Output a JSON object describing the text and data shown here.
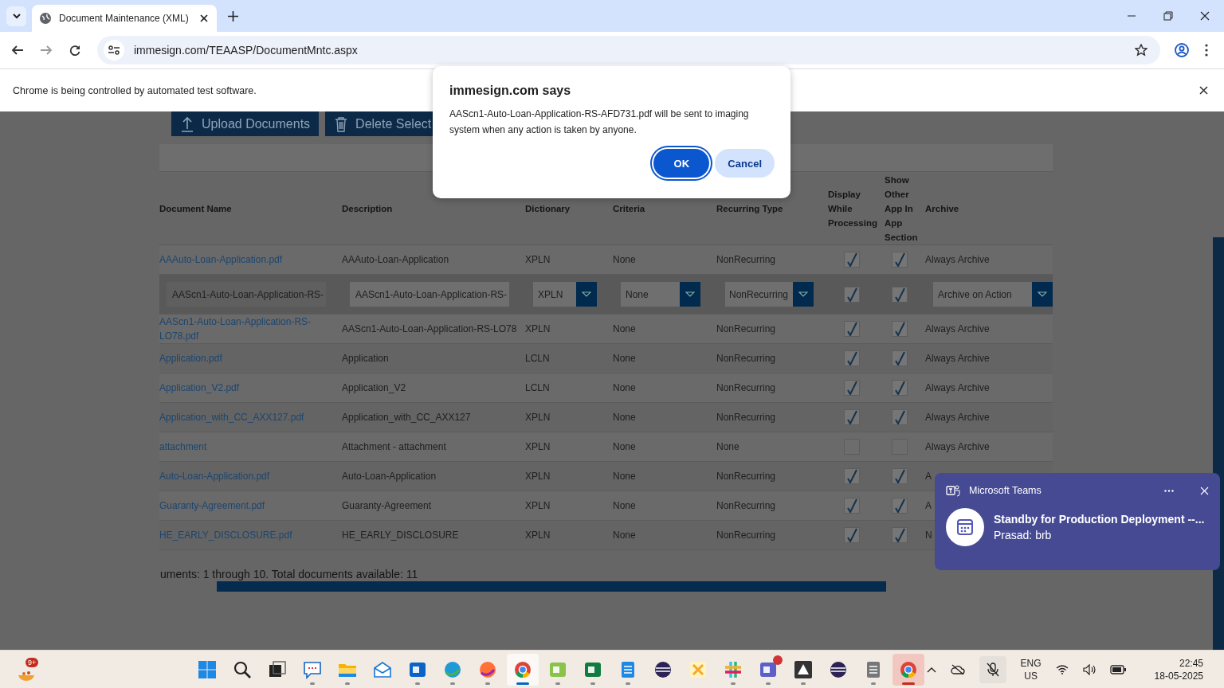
{
  "browser": {
    "tab_title": "Document Maintenance (XML)",
    "url": "immesign.com/TEAASP/DocumentMntc.aspx",
    "infobar": "Chrome is being controlled by automated test software."
  },
  "toolbar": {
    "buttons": [
      {
        "label": "Upload Documents",
        "kind": "upload"
      },
      {
        "label": "Delete Select",
        "kind": "delete"
      }
    ]
  },
  "table": {
    "columns": [
      "Document Name",
      "Description",
      "Dictionary",
      "Criteria",
      "Recurring Type",
      "Display While Processing",
      "Show Other App In App Section",
      "Archive"
    ],
    "rows": [
      {
        "kind": "view",
        "name": "AAAuto-Loan-Application.pdf",
        "description": "AAAuto-Loan-Application",
        "dictionary": "XPLN",
        "criteria": "None",
        "recurring_type": "NonRecurring",
        "display_while_processing": true,
        "show_other_app": true,
        "archive": "Always Archive"
      },
      {
        "kind": "edit",
        "name": "AAScn1-Auto-Loan-Application-RS-",
        "description": "AAScn1-Auto-Loan-Application-RS-",
        "dictionary": "XPLN",
        "criteria": "None",
        "recurring_type": "NonRecurring",
        "display_while_processing": true,
        "show_other_app": true,
        "archive": "Archive on Action"
      },
      {
        "kind": "view",
        "name": "AAScn1-Auto-Loan-Application-RS-LO78.pdf",
        "description": "AAScn1-Auto-Loan-Application-RS-LO78",
        "dictionary": "XPLN",
        "criteria": "None",
        "recurring_type": "NonRecurring",
        "display_while_processing": true,
        "show_other_app": true,
        "archive": "Always Archive"
      },
      {
        "kind": "view",
        "name": "Application.pdf",
        "description": "Application",
        "dictionary": "LCLN",
        "criteria": "None",
        "recurring_type": "NonRecurring",
        "display_while_processing": true,
        "show_other_app": true,
        "archive": "Always Archive"
      },
      {
        "kind": "view",
        "name": "Application_V2.pdf",
        "description": "Application_V2",
        "dictionary": "LCLN",
        "criteria": "None",
        "recurring_type": "NonRecurring",
        "display_while_processing": true,
        "show_other_app": true,
        "archive": "Always Archive"
      },
      {
        "kind": "view",
        "name": "Application_with_CC_AXX127.pdf",
        "description": "Application_with_CC_AXX127",
        "dictionary": "XPLN",
        "criteria": "None",
        "recurring_type": "NonRecurring",
        "display_while_processing": true,
        "show_other_app": true,
        "archive": "Always Archive"
      },
      {
        "kind": "view",
        "name": "attachment",
        "description": "Attachment - attachment",
        "dictionary": "XPLN",
        "criteria": "None",
        "recurring_type": "None",
        "display_while_processing": false,
        "show_other_app": false,
        "archive": "Always Archive"
      },
      {
        "kind": "view",
        "name": "Auto-Loan-Application.pdf",
        "description": "Auto-Loan-Application",
        "dictionary": "XPLN",
        "criteria": "None",
        "recurring_type": "NonRecurring",
        "display_while_processing": true,
        "show_other_app": true,
        "archive": "A"
      },
      {
        "kind": "view",
        "name": "Guaranty-Agreement.pdf",
        "description": "Guaranty-Agreement",
        "dictionary": "XPLN",
        "criteria": "None",
        "recurring_type": "NonRecurring",
        "display_while_processing": true,
        "show_other_app": true,
        "archive": "A"
      },
      {
        "kind": "view",
        "name": "HE_EARLY_DISCLOSURE.pdf",
        "description": "HE_EARLY_DISCLOSURE",
        "dictionary": "XPLN",
        "criteria": "None",
        "recurring_type": "NonRecurring",
        "display_while_processing": true,
        "show_other_app": true,
        "archive": "N"
      }
    ]
  },
  "footer": "uments: 1 through 10. Total documents available: 11",
  "dialog": {
    "title": "immesign.com says",
    "message": "AAScn1-Auto-Loan-Application-RS-AFD731.pdf will be sent to imaging system when any action is taken by anyone.",
    "buttons": [
      {
        "label": "OK",
        "primary": true
      },
      {
        "label": "Cancel",
        "primary": false
      }
    ]
  },
  "notification": {
    "app": "Microsoft Teams",
    "title": "Standby for Production Deployment --...",
    "body": "Prasad: brb"
  },
  "taskbar": {
    "weather_badge": "9+",
    "apps": [
      {
        "kind": "start",
        "running": false,
        "active": false,
        "attention": false,
        "alert": false
      },
      {
        "kind": "search",
        "running": false,
        "active": false,
        "attention": false,
        "alert": false
      },
      {
        "kind": "task-view",
        "running": false,
        "active": false,
        "attention": false,
        "alert": false
      },
      {
        "kind": "feedback",
        "running": true,
        "active": false,
        "attention": false,
        "alert": false
      },
      {
        "kind": "explorer",
        "running": true,
        "active": false,
        "attention": false,
        "alert": false
      },
      {
        "kind": "mail",
        "running": false,
        "active": false,
        "attention": false,
        "alert": false
      },
      {
        "kind": "outlook",
        "running": true,
        "active": false,
        "attention": false,
        "alert": false
      },
      {
        "kind": "edge",
        "running": true,
        "active": false,
        "attention": false,
        "alert": false
      },
      {
        "kind": "firefox",
        "running": true,
        "active": false,
        "attention": false,
        "alert": false
      },
      {
        "kind": "chrome",
        "running": true,
        "active": true,
        "attention": false,
        "alert": false
      },
      {
        "kind": "notepad-plus",
        "running": true,
        "active": false,
        "attention": false,
        "alert": false
      },
      {
        "kind": "excel",
        "running": true,
        "active": false,
        "attention": false,
        "alert": false
      },
      {
        "kind": "notepad",
        "running": true,
        "active": false,
        "attention": false,
        "alert": false
      },
      {
        "kind": "eclipse",
        "running": false,
        "active": false,
        "attention": false,
        "alert": false
      },
      {
        "kind": "tool",
        "running": false,
        "active": false,
        "attention": false,
        "alert": false
      },
      {
        "kind": "slack",
        "running": true,
        "active": false,
        "attention": false,
        "alert": false
      },
      {
        "kind": "teams",
        "running": true,
        "active": false,
        "attention": false,
        "alert": true
      },
      {
        "kind": "triangle",
        "running": true,
        "active": false,
        "attention": false,
        "alert": false
      },
      {
        "kind": "eclipse",
        "running": false,
        "active": false,
        "attention": false,
        "alert": false
      },
      {
        "kind": "java",
        "running": true,
        "active": false,
        "attention": false,
        "alert": false
      },
      {
        "kind": "chrome",
        "running": true,
        "active": false,
        "attention": true,
        "alert": false
      }
    ],
    "language": "ENG",
    "region": "US",
    "time": "22:45",
    "date": "18-05-2025"
  }
}
